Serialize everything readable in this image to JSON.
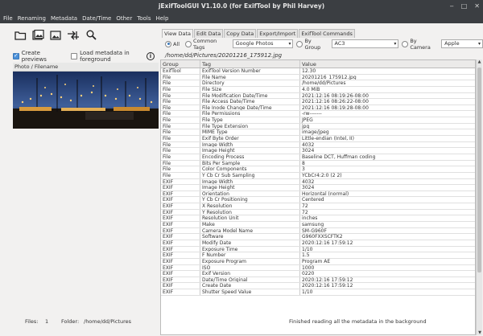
{
  "window": {
    "title": "jExifToolGUI V1.10.0  (for ExifTool by Phil Harvey)"
  },
  "menu": [
    "File",
    "Renaming",
    "Metadata",
    "Date/Time",
    "Other",
    "Tools",
    "Help"
  ],
  "toolbar_icons": [
    "folder-open-icon",
    "image-load-icon",
    "image-icon",
    "rotate-transfer-icon",
    "magnifier-icon"
  ],
  "options": {
    "create_previews": "Create previews",
    "load_metadata": "Load metadata in foreground",
    "info": "i"
  },
  "file_list": {
    "header": "Photo / Filename"
  },
  "tabs": [
    "View Data",
    "Edit Data",
    "Copy Data",
    "Export/Import",
    "ExifTool Commands"
  ],
  "filters": {
    "all": "All",
    "common_tags": "Common Tags",
    "common_tags_value": "Google Photos",
    "by_group": "By Group",
    "group_value": "AC3",
    "by_camera": "By Camera",
    "camera_value": "Apple"
  },
  "file_path": "/home/dd/Pictures/20201216_175912.jpg",
  "table": {
    "headers": [
      "Group",
      "Tag",
      "Value"
    ],
    "rows": [
      [
        "ExifTool",
        "ExifTool Version Number",
        "12.30"
      ],
      [
        "File",
        "File Name",
        "20201216_175912.jpg"
      ],
      [
        "File",
        "Directory",
        "/home/dd/Pictures"
      ],
      [
        "File",
        "File Size",
        "4.0 MiB"
      ],
      [
        "File",
        "File Modification Date/Time",
        "2021:12:16 08:19:26-08:00"
      ],
      [
        "File",
        "File Access Date/Time",
        "2021:12:16 08:26:22-08:00"
      ],
      [
        "File",
        "File Inode Change Date/Time",
        "2021:12:16 08:19:28-08:00"
      ],
      [
        "File",
        "File Permissions",
        "-rw-------"
      ],
      [
        "File",
        "File Type",
        "JPEG"
      ],
      [
        "File",
        "File Type Extension",
        "jpg"
      ],
      [
        "File",
        "MIME Type",
        "image/jpeg"
      ],
      [
        "File",
        "Exif Byte Order",
        "Little-endian (Intel, II)"
      ],
      [
        "File",
        "Image Width",
        "4032"
      ],
      [
        "File",
        "Image Height",
        "3024"
      ],
      [
        "File",
        "Encoding Process",
        "Baseline DCT, Huffman coding"
      ],
      [
        "File",
        "Bits Per Sample",
        "8"
      ],
      [
        "File",
        "Color Components",
        "3"
      ],
      [
        "File",
        "Y Cb Cr Sub Sampling",
        "YCbCr4:2:0 (2 2)"
      ],
      [
        "EXIF",
        "Image Width",
        "4032"
      ],
      [
        "EXIF",
        "Image Height",
        "3024"
      ],
      [
        "EXIF",
        "Orientation",
        "Horizontal (normal)"
      ],
      [
        "EXIF",
        "Y Cb Cr Positioning",
        "Centered"
      ],
      [
        "EXIF",
        "X Resolution",
        "72"
      ],
      [
        "EXIF",
        "Y Resolution",
        "72"
      ],
      [
        "EXIF",
        "Resolution Unit",
        "inches"
      ],
      [
        "EXIF",
        "Make",
        "samsung"
      ],
      [
        "EXIF",
        "Camera Model Name",
        "SM-G960F"
      ],
      [
        "EXIF",
        "Software",
        "G960FXXSCFTK2"
      ],
      [
        "EXIF",
        "Modify Date",
        "2020:12:16 17:59:12"
      ],
      [
        "EXIF",
        "Exposure Time",
        "1/10"
      ],
      [
        "EXIF",
        "F Number",
        "1.5"
      ],
      [
        "EXIF",
        "Exposure Program",
        "Program AE"
      ],
      [
        "EXIF",
        "ISO",
        "1000"
      ],
      [
        "EXIF",
        "Exif Version",
        "0220"
      ],
      [
        "EXIF",
        "Date/Time Original",
        "2020:12:16 17:59:12"
      ],
      [
        "EXIF",
        "Create Date",
        "2020:12:16 17:59:12"
      ],
      [
        "EXIF",
        "Shutter Speed Value",
        "1/10"
      ]
    ]
  },
  "status": {
    "files_label": "Files:",
    "files_count": "1",
    "folder_label": "Folder:",
    "folder_path": "/home/dd/Pictures",
    "message": "Finished reading all the metadata in the background"
  }
}
